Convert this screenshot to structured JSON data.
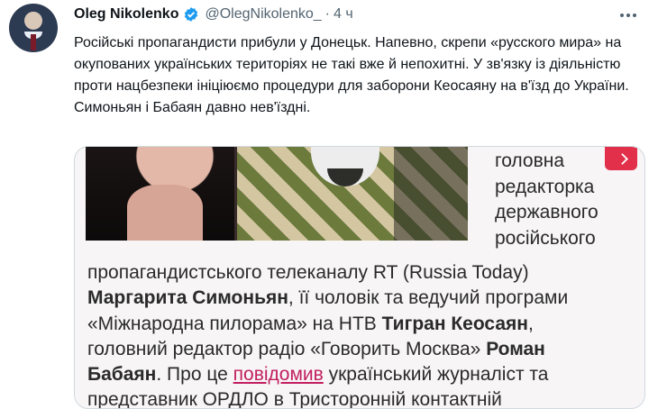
{
  "tweet": {
    "author": {
      "name": "Oleg Nikolenko",
      "handle": "@OlegNikolenko_",
      "time": "4 ч",
      "separator": "·",
      "verified": true
    },
    "text": "Російські пропагандисти прибули у Донецьк. Напевно, скрепи «русского мира» на окупованих українських територіях не такі вже й непохитні. У зв'язку із діяльністю проти нацбезпеки ініціюємо процедури для заборони Кеосаяну на в'їзд до України. Симоньян і Бабаян давно нев'їздні.",
    "colors": {
      "accent": "#1d9bf0",
      "link": "#c21f5f",
      "badge": "#e2304b"
    }
  },
  "media": {
    "side_lines": [
      "головна",
      "редакторка",
      "державного",
      "російського"
    ],
    "article": {
      "l1": "пропагандистського телеканалу RT (Russia Today)",
      "l2a": "Маргарита Симоньян",
      "l2b": ", її чоловік та ведучий програми",
      "l3a": "«Міжнародна пилорама» на НТВ ",
      "l3b": "Тигран Кеосаян",
      "l3c": ",",
      "l4a": "головний редактор радіо «Говорить Москва» ",
      "l4b": "Роман",
      "l5a": "Бабаян",
      "l5b": ". Про це ",
      "l5link": "повідомив",
      "l5c": " український журналіст та",
      "l6": "представник ОРДЛО в Тристоронній контактній"
    }
  }
}
